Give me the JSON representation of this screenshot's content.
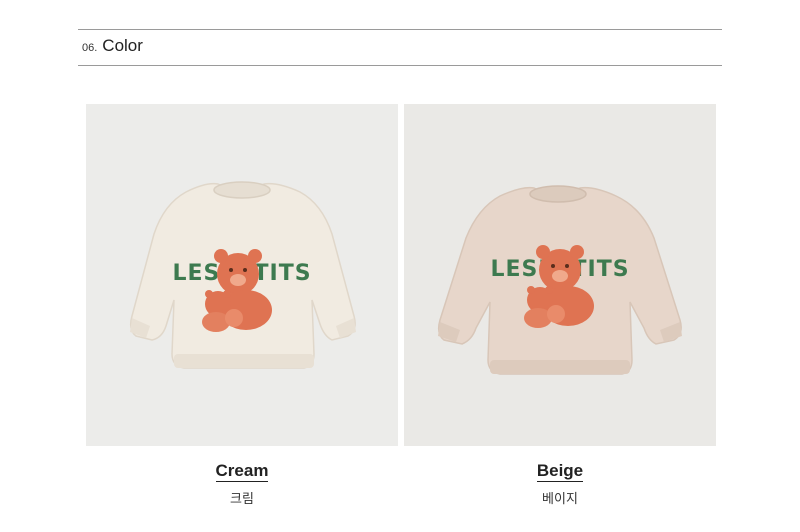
{
  "section": {
    "number": "06.",
    "title": "Color"
  },
  "products": [
    {
      "name_en": "Cream",
      "name_ko": "크림",
      "print_text": "LESPETITS",
      "icon": "sweatshirt-photo",
      "colors": {
        "fabric": "#f1ebe1",
        "fabric_shade": "#e2dacd",
        "background": "#ececea"
      }
    },
    {
      "name_en": "Beige",
      "name_ko": "베이지",
      "print_text": "LESPETITS",
      "icon": "sweatshirt-photo",
      "colors": {
        "fabric": "#e7d6ca",
        "fabric_shade": "#d6c3b5",
        "background": "#eae9e6"
      }
    }
  ],
  "print_colors": {
    "lettering": "#3d7a4f",
    "bear": "#df7352",
    "bear_dark": "#b9553a"
  }
}
